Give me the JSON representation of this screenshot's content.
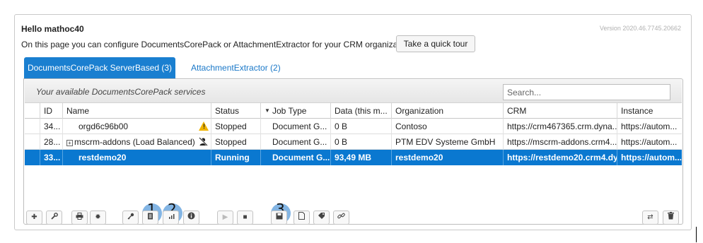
{
  "header": {
    "greeting": "Hello mathoc40",
    "version": "Version 2020.46.7745.20662",
    "intro": "On this page you can configure DocumentsCorePack or AttachmentExtractor for your CRM organization.",
    "tour_button": "Take a quick tour"
  },
  "tabs": [
    {
      "label": "DocumentsCorePack ServerBased (3)",
      "active": true
    },
    {
      "label": "AttachmentExtractor (2)",
      "active": false
    }
  ],
  "panel": {
    "title": "Your available DocumentsCorePack services",
    "search_placeholder": "Search..."
  },
  "table": {
    "columns": [
      "ID",
      "Name",
      "Status",
      "Job Type",
      "Data (this m...",
      "Organization",
      "CRM",
      "Instance"
    ],
    "rows": [
      {
        "id": "34...",
        "name": "orgd6c96b00",
        "status": "Stopped",
        "job": "Document G...",
        "data": "0 B",
        "org": "Contoso",
        "crm": "https://crm467365.crm.dyna...",
        "instance": "https://autom...",
        "flag": "warning-icon"
      },
      {
        "id": "28...",
        "name": "mscrm-addons (Load Balanced)",
        "status": "Stopped",
        "job": "Document G...",
        "data": "0 B",
        "org": "PTM EDV Systeme GmbH",
        "crm": "https://mscrm-addons.crm4....",
        "instance": "https://autom...",
        "flag": "user-disabled-icon"
      },
      {
        "id": "33...",
        "name": "restdemo20",
        "status": "Running",
        "job": "Document G...",
        "data": "93,49 MB",
        "org": "restdemo20",
        "crm": "https://restdemo20.crm4.dy...",
        "instance": "https://autom...",
        "selected": true
      }
    ]
  },
  "toolbar": {
    "icons": [
      "plus-icon",
      "wrench-icon",
      "print-icon",
      "gear-icon",
      "key-icon",
      "list-icon",
      "bar-chart-icon",
      "info-icon",
      "play-icon",
      "stop-icon",
      "save-icon",
      "document-icon",
      "tag-icon",
      "link-icon",
      "swap-icon",
      "trash-icon"
    ]
  },
  "annotations": [
    "1",
    "2",
    "3"
  ],
  "colors": {
    "accent": "#1a7fd0",
    "selected_row": "#0a78d0",
    "highlight": "#1e78cd",
    "warning": "#f0b400"
  }
}
